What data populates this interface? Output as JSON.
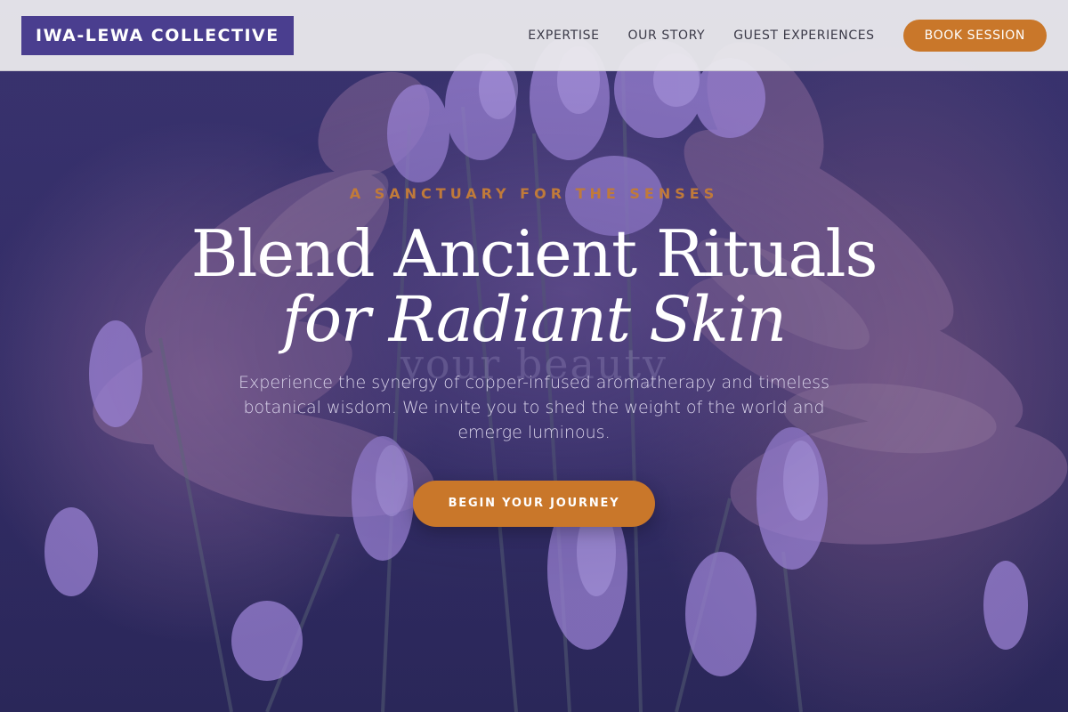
{
  "colors": {
    "brand": "#4a3e8f",
    "accent": "#c9772a",
    "overlay": "#2c2a5e",
    "eyebrow": "#c07a3a"
  },
  "header": {
    "logo": "IWA-LEWA COLLECTIVE",
    "nav": [
      {
        "label": "EXPERTISE"
      },
      {
        "label": "OUR STORY"
      },
      {
        "label": "GUEST EXPERIENCES"
      }
    ],
    "cta_label": "BOOK SESSION"
  },
  "hero": {
    "background_icon": "lavender-hands-photo",
    "eyebrow": "A SANCTUARY FOR THE SENSES",
    "headline_line1": "Blend Ancient Rituals",
    "headline_line2": "for Radiant Skin",
    "ghost_word": "your beauty",
    "body": "Experience the synergy of copper-infused aromatherapy and timeless botanical wisdom. We invite you to shed the weight of the world and emerge luminous.",
    "cta_label": "BEGIN YOUR JOURNEY"
  }
}
